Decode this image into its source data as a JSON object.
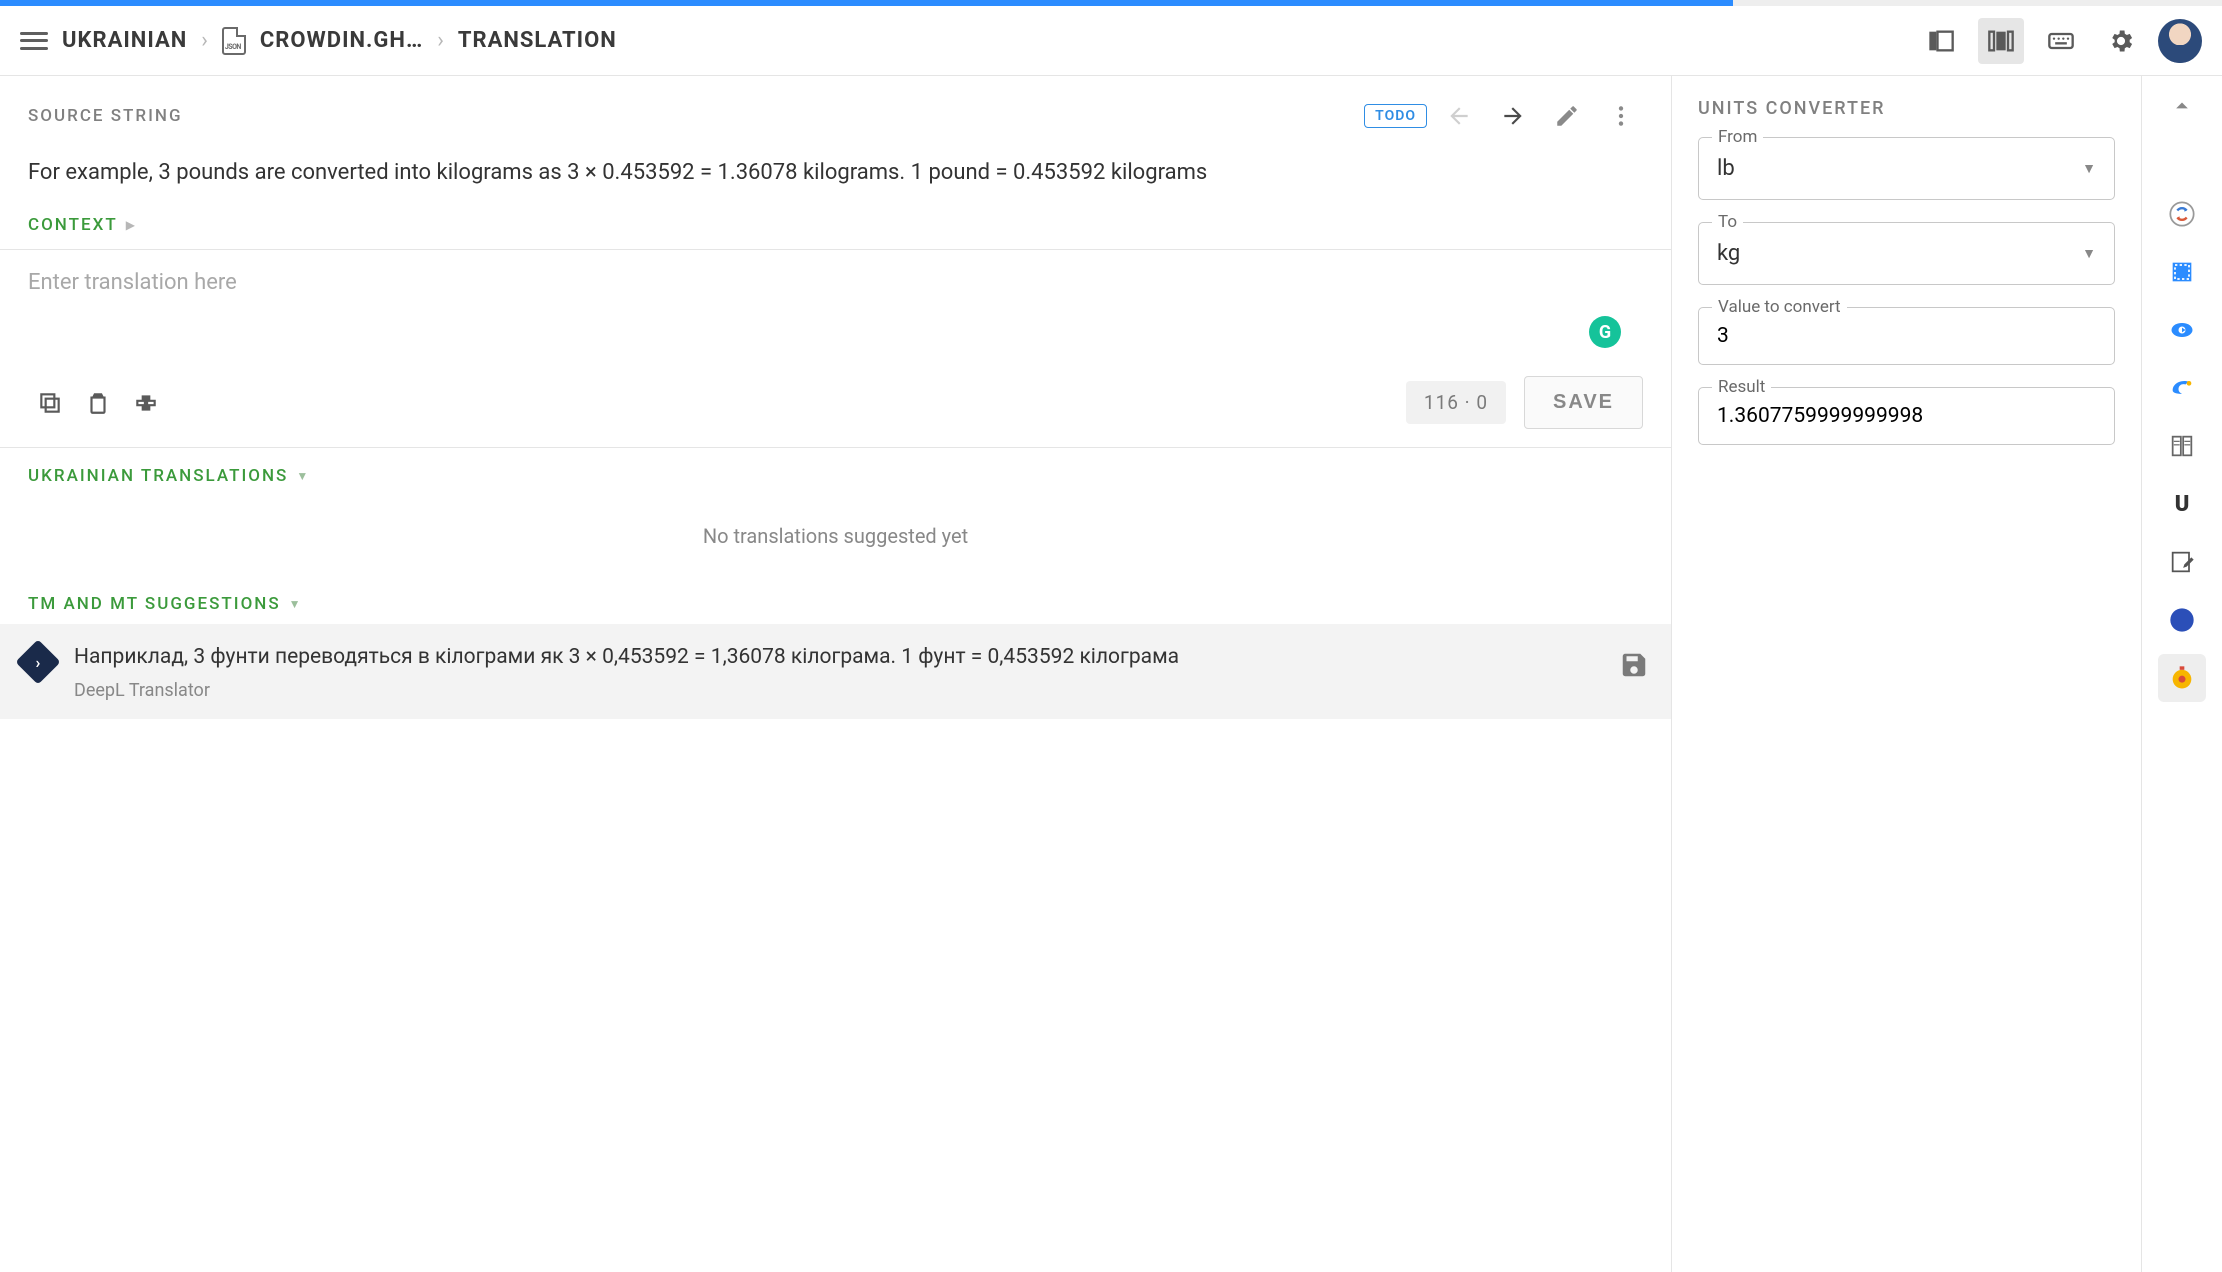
{
  "progress_pct": 78,
  "breadcrumb": {
    "language": "UKRAINIAN",
    "file": "CROWDIN.GH…",
    "page": "TRANSLATION"
  },
  "source": {
    "label": "SOURCE STRING",
    "badge": "TODO",
    "text": "For example, 3 pounds are converted into kilograms as 3 × 0.453592 = 1.36078 kilograms. 1 pound = 0.453592 kilograms",
    "context_label": "CONTEXT"
  },
  "editor": {
    "placeholder": "Enter translation here",
    "value": "",
    "count": "116  ·  0",
    "save_label": "SAVE"
  },
  "translations": {
    "heading": "UKRAINIAN TRANSLATIONS",
    "empty": "No translations suggested yet"
  },
  "suggestions": {
    "heading": "TM AND MT SUGGESTIONS",
    "items": [
      {
        "text": "Наприклад, 3 фунти переводяться в кілограми як 3 × 0,453592 = 1,36078 кілограма. 1 фунт = 0,453592 кілограма",
        "source": "DeepL Translator"
      }
    ]
  },
  "converter": {
    "title": "UNITS CONVERTER",
    "from_label": "From",
    "from_value": "lb",
    "to_label": "To",
    "to_value": "kg",
    "value_label": "Value to convert",
    "value": "3",
    "result_label": "Result",
    "result": "1.3607759999999998"
  },
  "rail": {
    "u_label": "U"
  }
}
